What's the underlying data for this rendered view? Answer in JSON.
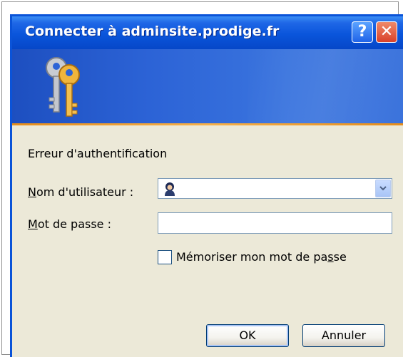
{
  "dialog": {
    "title": "Connecter à adminsite.prodige.fr",
    "help_glyph": "?",
    "close_glyph": "✕",
    "error_message": "Erreur d'authentification",
    "username": {
      "label_accel": "N",
      "label_rest": "om d'utilisateur :",
      "value": "",
      "icon": "user-avatar-icon"
    },
    "password": {
      "label_accel": "M",
      "label_rest": "ot de passe :",
      "value": ""
    },
    "remember": {
      "label_before": "Mémoriser mon mot de pa",
      "label_accel": "s",
      "label_after": "se",
      "checked": false
    },
    "buttons": {
      "ok": "OK",
      "cancel": "Annuler"
    }
  },
  "colors": {
    "titlebar": "#0a55db",
    "banner": "#2c63d6",
    "banner_line": "#e58d1c",
    "dialog_bg": "#ece9d8",
    "close_button": "#d9412a"
  }
}
